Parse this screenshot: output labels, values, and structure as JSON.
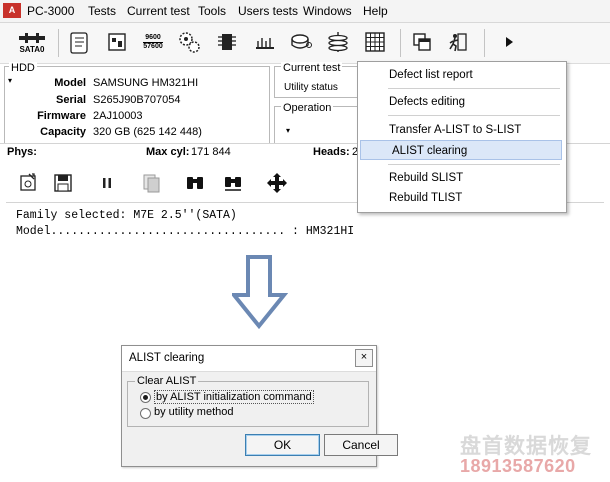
{
  "app": {
    "logo_text": "A",
    "title": "PC-3000"
  },
  "menubar": {
    "items": [
      "Tests",
      "Current test",
      "Tools",
      "Users tests",
      "Windows",
      "Help"
    ]
  },
  "toolbar": {
    "sata_label": "SATA0",
    "sata_icon": "sata-port-icon",
    "speed_label_1": "9600",
    "speed_label_2": "57600",
    "icons": [
      "script-icon",
      "terminal-icon",
      "baud-rate-icon",
      "gear-stack-icon",
      "chip-icon",
      "power-meter-icon",
      "disk-cup-icon",
      "platter-stack-icon",
      "grid-icon",
      "windows-icon",
      "running-man-icon",
      "play-icon"
    ]
  },
  "hdd": {
    "group_label": "HDD",
    "model_label": "Model",
    "model_value": "SAMSUNG HM321HI",
    "serial_label": "Serial",
    "serial_value": "S265J90B707054",
    "firmware_label": "Firmware",
    "firmware_value": "2AJ10003",
    "capacity_label": "Capacity",
    "capacity_value": "320 GB (625 142 448)"
  },
  "current_test": {
    "label": "Current test",
    "status": "Utility status"
  },
  "operation": {
    "label": "Operation"
  },
  "phys_bar": {
    "phys_label": "Phys:",
    "maxcyl_label": "Max cyl:",
    "maxcyl_value": "171 844",
    "heads_label": "Heads:",
    "heads_value": "2"
  },
  "dropdown": {
    "items": [
      {
        "label": "Defect list report"
      },
      {
        "label": "Defects editing"
      },
      {
        "label": "Transfer A-LIST to S-LIST"
      },
      {
        "label": "ALIST clearing"
      },
      {
        "label": "Rebuild SLIST"
      },
      {
        "label": "Rebuild TLIST"
      }
    ],
    "selected": "ALIST clearing",
    "highlight_color": "#dbe7f8"
  },
  "toolbar2": {
    "icons": [
      "export-icon",
      "save-icon",
      "pause-icon",
      "copy-icon",
      "binoculars-icon",
      "binoculars-list-icon",
      "move-arrows-icon"
    ]
  },
  "log": {
    "line1": "Family selected: M7E 2.5''(SATA)",
    "line2": "Model.................................. : HM321HI"
  },
  "arrow": {
    "icon": "down-arrow-icon",
    "color": "#6b88b3"
  },
  "dialog": {
    "title": "ALIST clearing",
    "close_label": "×",
    "group_label": "Clear ALIST",
    "option1": "by ALIST initialization command",
    "option2": "by utility method",
    "selected_option": 1,
    "ok_label": "OK",
    "cancel_label": "Cancel"
  },
  "watermark": {
    "line1": "盘首数据恢复",
    "line2": "18913587620"
  }
}
